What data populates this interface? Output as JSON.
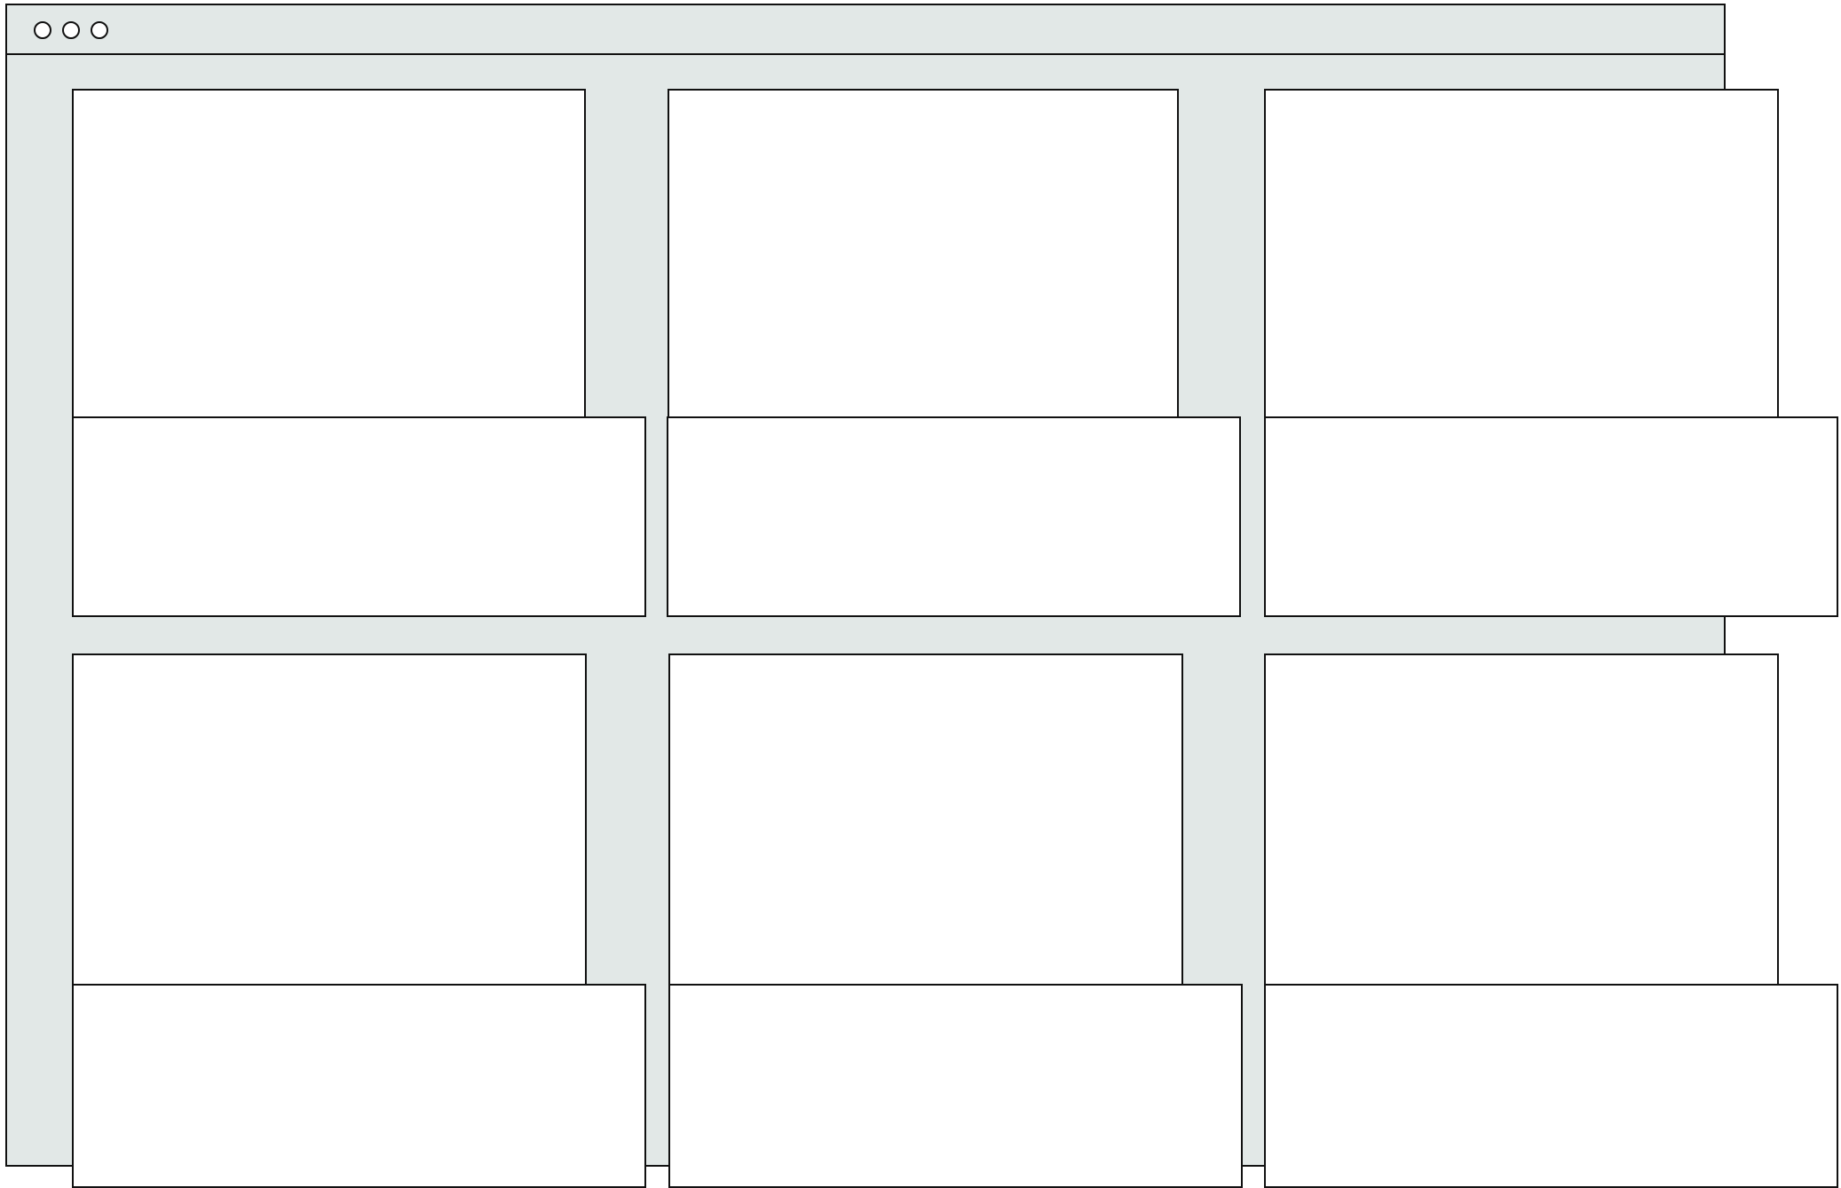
{
  "window": {
    "background_color": "#e2e8e7",
    "border_color": "#111111",
    "control_icons": [
      "circle-icon",
      "circle-icon",
      "circle-icon"
    ]
  },
  "cards": [
    {
      "image": {
        "text": ""
      },
      "panel": {
        "text": ""
      }
    },
    {
      "image": {
        "text": ""
      },
      "panel": {
        "text": ""
      }
    },
    {
      "image": {
        "text": ""
      },
      "panel": {
        "text": ""
      }
    },
    {
      "image": {
        "text": ""
      },
      "panel": {
        "text": ""
      }
    },
    {
      "image": {
        "text": ""
      },
      "panel": {
        "text": ""
      }
    },
    {
      "image": {
        "text": ""
      },
      "panel": {
        "text": ""
      }
    }
  ]
}
